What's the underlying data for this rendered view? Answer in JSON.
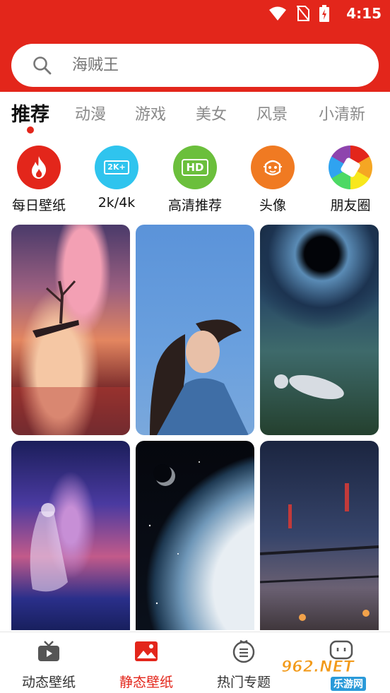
{
  "status_bar": {
    "time": "4:15",
    "icons": [
      "wifi-icon",
      "no-sim-icon",
      "battery-charging-icon"
    ]
  },
  "search": {
    "placeholder": "海贼王"
  },
  "tabs": [
    {
      "label": "推荐",
      "active": true
    },
    {
      "label": "动漫"
    },
    {
      "label": "游戏"
    },
    {
      "label": "美女"
    },
    {
      "label": "风景"
    },
    {
      "label": "小清新"
    }
  ],
  "quick_categories": [
    {
      "label": "每日壁纸",
      "icon": "flame-icon",
      "color": "#e3261b"
    },
    {
      "label": "2k/4k",
      "icon": "2k-badge-icon",
      "icon_text": "2K+",
      "color": "#2fc4ee"
    },
    {
      "label": "高清推荐",
      "icon": "hd-icon",
      "icon_text": "HD",
      "color": "#6bbf3c"
    },
    {
      "label": "头像",
      "icon": "avatar-face-icon",
      "color": "#f07a22"
    },
    {
      "label": "朋友圈",
      "icon": "aperture-icon",
      "color": "#multi"
    }
  ],
  "wallpapers": [
    {
      "name": "wallpaper-cherry-tree-clouds",
      "scene": "cherry tree on cliff above clouds at sunset"
    },
    {
      "name": "wallpaper-girl-blue-sky",
      "scene": "girl with glasses against blue sky"
    },
    {
      "name": "wallpaper-astronaut-vortex",
      "scene": "astronaut floating under cosmic vortex"
    },
    {
      "name": "wallpaper-anime-girl-galaxy",
      "scene": "anime girl in starry galaxy reflection"
    },
    {
      "name": "wallpaper-earth-from-space",
      "scene": "earth horizon and moon in space"
    },
    {
      "name": "wallpaper-wind-chimes-night",
      "scene": "wind chimes on balcony at night"
    }
  ],
  "bottom_nav": [
    {
      "label": "动态壁纸",
      "icon": "tv-icon"
    },
    {
      "label": "静态壁纸",
      "icon": "picture-icon",
      "active": true
    },
    {
      "label": "热门专题",
      "icon": "topic-list-icon"
    },
    {
      "label": "",
      "icon": "chat-bubble-icon"
    }
  ],
  "watermark": {
    "text_main": "962.NET",
    "text_sub": "乐游网"
  },
  "colors": {
    "brand_red": "#e3261b",
    "active_text": "#111111",
    "inactive_text": "#8a8a8a"
  }
}
